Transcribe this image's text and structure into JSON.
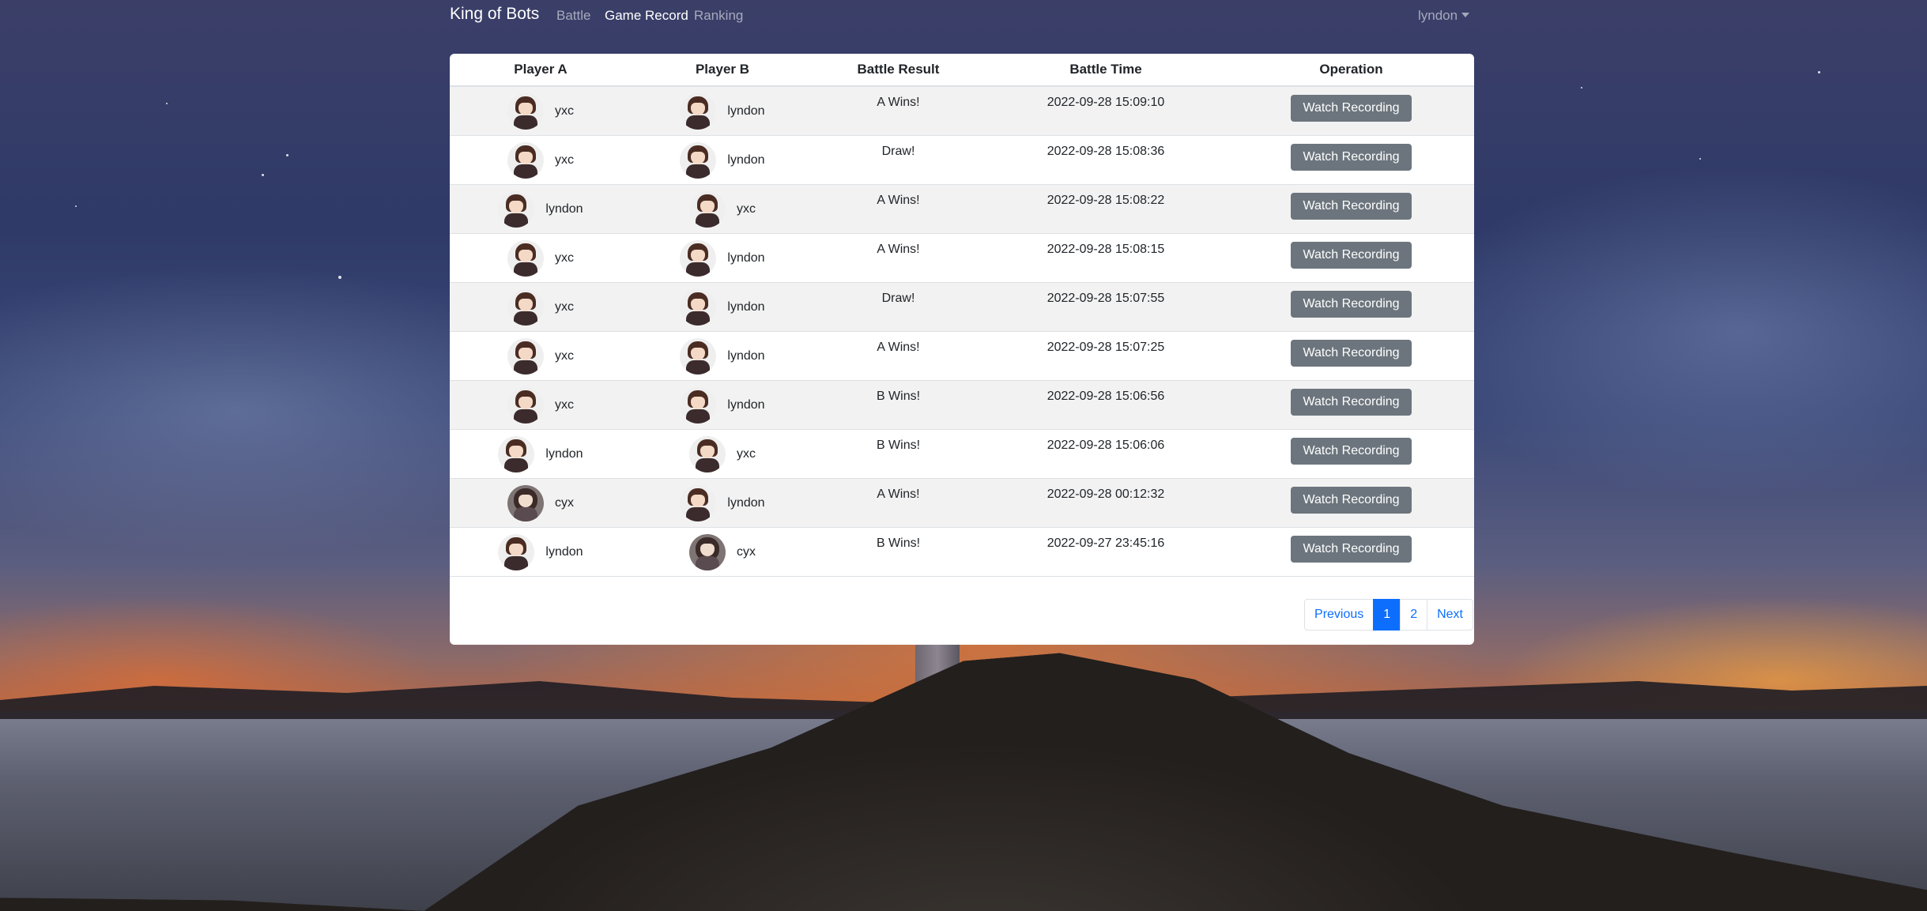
{
  "navbar": {
    "brand": "King of Bots",
    "links": [
      {
        "label": "Battle",
        "active": false
      },
      {
        "label": "Game Record",
        "active": true
      },
      {
        "label": "Ranking",
        "active": false
      }
    ],
    "user": "lyndon"
  },
  "table": {
    "headers": [
      "Player A",
      "Player B",
      "Battle Result",
      "Battle Time",
      "Operation"
    ],
    "rows": [
      {
        "a": "yxc",
        "b": "lyndon",
        "result": "A Wins!",
        "time": "2022-09-28 15:09:10",
        "op": "Watch Recording"
      },
      {
        "a": "yxc",
        "b": "lyndon",
        "result": "Draw!",
        "time": "2022-09-28 15:08:36",
        "op": "Watch Recording"
      },
      {
        "a": "lyndon",
        "b": "yxc",
        "result": "A Wins!",
        "time": "2022-09-28 15:08:22",
        "op": "Watch Recording"
      },
      {
        "a": "yxc",
        "b": "lyndon",
        "result": "A Wins!",
        "time": "2022-09-28 15:08:15",
        "op": "Watch Recording"
      },
      {
        "a": "yxc",
        "b": "lyndon",
        "result": "Draw!",
        "time": "2022-09-28 15:07:55",
        "op": "Watch Recording"
      },
      {
        "a": "yxc",
        "b": "lyndon",
        "result": "A Wins!",
        "time": "2022-09-28 15:07:25",
        "op": "Watch Recording"
      },
      {
        "a": "yxc",
        "b": "lyndon",
        "result": "B Wins!",
        "time": "2022-09-28 15:06:56",
        "op": "Watch Recording"
      },
      {
        "a": "lyndon",
        "b": "yxc",
        "result": "B Wins!",
        "time": "2022-09-28 15:06:06",
        "op": "Watch Recording"
      },
      {
        "a": "cyx",
        "b": "lyndon",
        "result": "A Wins!",
        "time": "2022-09-28 00:12:32",
        "op": "Watch Recording"
      },
      {
        "a": "lyndon",
        "b": "cyx",
        "result": "B Wins!",
        "time": "2022-09-27 23:45:16",
        "op": "Watch Recording"
      }
    ]
  },
  "pagination": {
    "previous": "Previous",
    "pages": [
      "1",
      "2"
    ],
    "active_page": "1",
    "next": "Next"
  },
  "colors": {
    "primary": "#0d6efd",
    "button_secondary": "#6c757d",
    "stripe": "#f2f2f2"
  }
}
